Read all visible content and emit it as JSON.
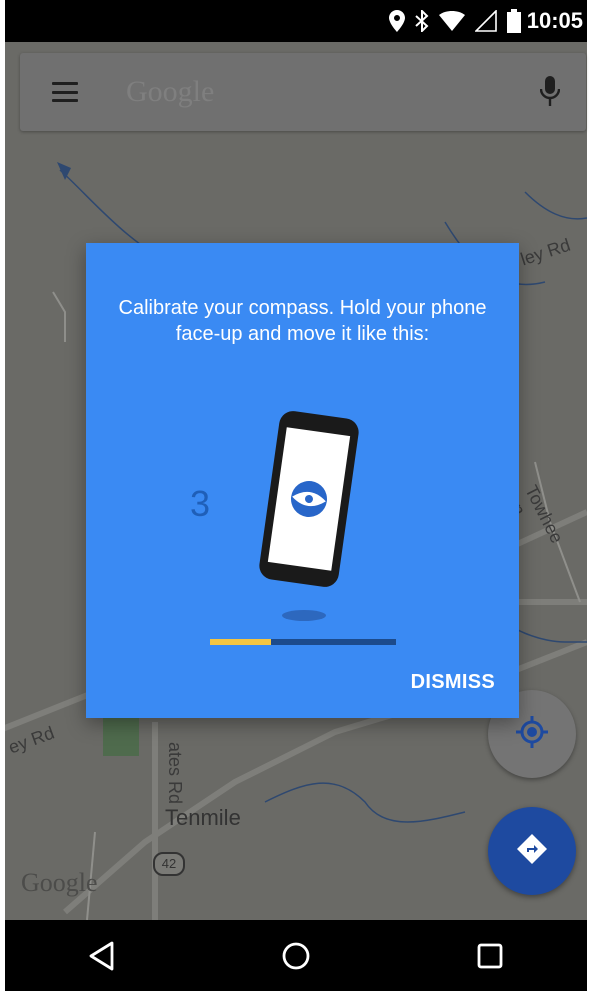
{
  "status_bar": {
    "time": "10:05",
    "icons": [
      "location-icon",
      "bluetooth-icon",
      "wifi-icon",
      "signal-icon",
      "battery-icon"
    ]
  },
  "search": {
    "placeholder": "Google",
    "menu_icon": "menu-icon",
    "mic_icon": "mic-icon"
  },
  "map": {
    "labels": {
      "road_1": "ley Rd",
      "road_2": "ey Rd",
      "road_3": "ates Rd",
      "road_4": "Towhee Ln",
      "town": "Tenmile",
      "route": "42",
      "watermark": "Google"
    },
    "fab_location_icon": "my-location-icon",
    "fab_directions_icon": "directions-icon"
  },
  "dialog": {
    "message": "Calibrate your compass. Hold your phone face-up and move it like this:",
    "countdown": "3",
    "progress": 0.33,
    "dismiss_label": "DISMISS",
    "illustration_icon": "phone-compass-icon"
  },
  "nav_bar": {
    "back_icon": "back-icon",
    "home_icon": "home-icon",
    "recents_icon": "recents-icon"
  },
  "colors": {
    "dialog_bg": "#3a8af3",
    "progress_fill": "#f4c542",
    "progress_track": "#1c4b8c",
    "fab_directions": "#1e4aa0"
  }
}
